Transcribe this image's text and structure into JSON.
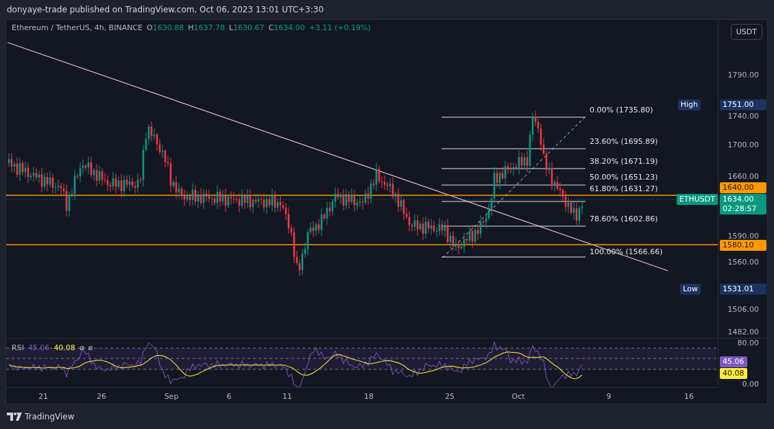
{
  "header": {
    "text": "donyaye-trade published on TradingView.com, Oct 06, 2023 13:01 UTC+3:30"
  },
  "legend": {
    "symbol": "Ethereum / TetherUS, 4h, BINANCE",
    "ohlc": [
      {
        "key": "O",
        "value": "1630.88"
      },
      {
        "key": "H",
        "value": "1637.78"
      },
      {
        "key": "L",
        "value": "1630.67"
      },
      {
        "key": "C",
        "value": "1634.00"
      }
    ],
    "change": "+3.11 (+0.19%)"
  },
  "currency_button": {
    "label": "USDT"
  },
  "fib_levels": [
    {
      "label": "0.00% (1735.80)"
    },
    {
      "label": "23.60% (1695.89)"
    },
    {
      "label": "38.20% (1671.19)"
    },
    {
      "label": "50.00% (1651.23)"
    },
    {
      "label": "61.80% (1631.27)"
    },
    {
      "label": "78.60% (1602.86)"
    },
    {
      "label": "100.00% (1566.66)"
    }
  ],
  "price_axis": {
    "labels": [
      "1790.00",
      "1740.00",
      "1700.00",
      "1660.00",
      "1590.00",
      "1560.00",
      "1506.00",
      "1482.00"
    ],
    "badges": [
      {
        "kind": "high",
        "label": "High",
        "value": "1751.00"
      },
      {
        "kind": "level",
        "value": "1640.00"
      },
      {
        "kind": "last",
        "label": "ETHUSDT",
        "value": "1634.00",
        "countdown": "02:28:57"
      },
      {
        "kind": "level",
        "value": "1580.10"
      },
      {
        "kind": "low",
        "label": "Low",
        "value": "1531.01"
      }
    ]
  },
  "rsi": {
    "label": "RSI",
    "value": "45.06",
    "signal": "40.08",
    "extras": [
      "ø",
      "ø"
    ],
    "axis_labels": [
      "80.00",
      "0.00"
    ],
    "badges": [
      {
        "value": "45.06",
        "color": "#7e57c2"
      },
      {
        "value": "40.08",
        "color": "#ffeb3b"
      }
    ]
  },
  "time_axis": {
    "labels": [
      "21",
      "26",
      "Sep",
      "6",
      "11",
      "18",
      "25",
      "Oct",
      "9",
      "16"
    ]
  },
  "footer": {
    "brand": "TradingView"
  }
}
